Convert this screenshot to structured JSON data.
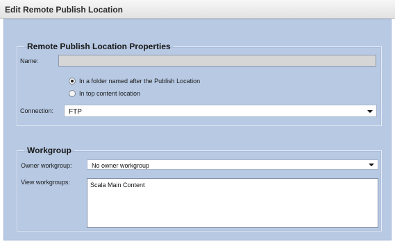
{
  "window": {
    "title": "Edit Remote Publish Location"
  },
  "properties": {
    "legend": "Remote Publish Location Properties",
    "name_label": "Name:",
    "name_value": "",
    "radio_folder": "In a folder named after the Publish Location",
    "radio_top": "In top content location",
    "radio_selected": "folder",
    "connection_label": "Connection:",
    "connection_value": "FTP"
  },
  "workgroup": {
    "legend": "Workgroup",
    "owner_label": "Owner workgroup:",
    "owner_value": "No owner workgroup",
    "view_label": "View workgroups:",
    "view_items": [
      "Scala Main Content"
    ]
  },
  "icons": {
    "dropdown": "chevron-down-icon",
    "radio": "radio-icon"
  }
}
